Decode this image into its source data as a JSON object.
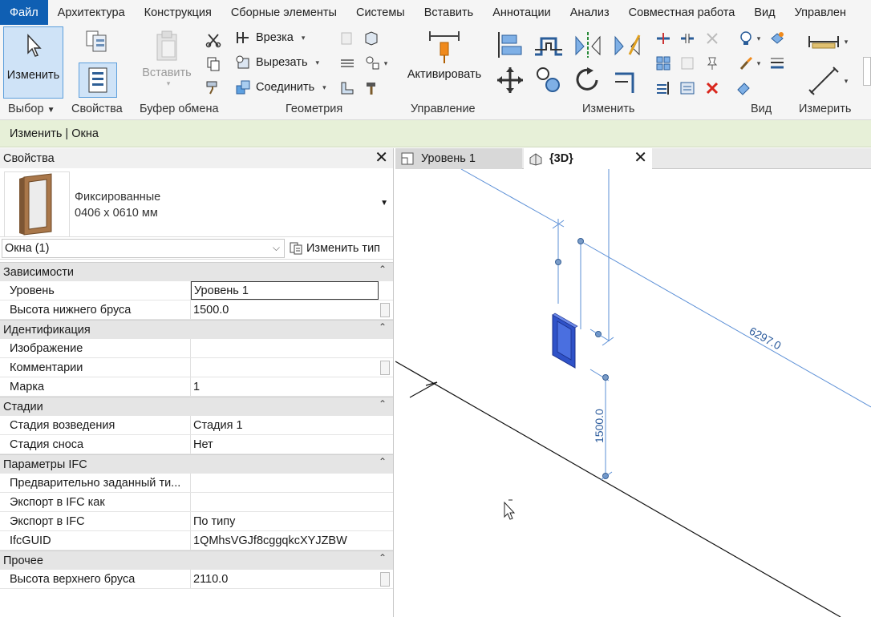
{
  "menu": {
    "tabs": [
      {
        "label": "Файл"
      },
      {
        "label": "Архитектура"
      },
      {
        "label": "Конструкция"
      },
      {
        "label": "Сборные элементы"
      },
      {
        "label": "Системы"
      },
      {
        "label": "Вставить"
      },
      {
        "label": "Аннотации"
      },
      {
        "label": "Анализ"
      },
      {
        "label": "Совместная работа"
      },
      {
        "label": "Вид"
      },
      {
        "label": "Управлен"
      }
    ]
  },
  "ribbon": {
    "modify_label": "Изменить",
    "paste_label": "Вставить",
    "cope_label": "Врезка",
    "cut_label": "Вырезать",
    "join_label": "Соединить",
    "activate_label": "Активировать",
    "panels": {
      "select": "Выбор",
      "properties": "Свойства",
      "clipboard": "Буфер обмена",
      "geometry": "Геометрия",
      "control": "Управление",
      "modify": "Изменить",
      "view": "Вид",
      "measure": "Измерить"
    }
  },
  "context": {
    "text": "Изменить | Окна"
  },
  "properties": {
    "title": "Свойства",
    "type_name_line1": "Фиксированные",
    "type_name_line2": "0406 x 0610 мм",
    "instance_selector": "Окна (1)",
    "edit_type_label": "Изменить тип",
    "groups": [
      {
        "name": "Зависимости",
        "rows": [
          {
            "name": "Уровень",
            "value": "Уровень 1"
          },
          {
            "name": "Высота нижнего бруса",
            "value": "1500.0"
          }
        ]
      },
      {
        "name": "Идентификация",
        "rows": [
          {
            "name": "Изображение",
            "value": ""
          },
          {
            "name": "Комментарии",
            "value": ""
          },
          {
            "name": "Марка",
            "value": "1"
          }
        ]
      },
      {
        "name": "Стадии",
        "rows": [
          {
            "name": "Стадия возведения",
            "value": "Стадия 1"
          },
          {
            "name": "Стадия сноса",
            "value": "Нет"
          }
        ]
      },
      {
        "name": "Параметры IFC",
        "rows": [
          {
            "name": "Предварительно заданный ти...",
            "value": ""
          },
          {
            "name": "Экспорт в IFC как",
            "value": ""
          },
          {
            "name": "Экспорт в IFC",
            "value": "По типу"
          },
          {
            "name": "IfcGUID",
            "value": "1QMhsVGJf8cggqkcXYJZBW"
          }
        ]
      },
      {
        "name": "Прочее",
        "rows": [
          {
            "name": "Высота верхнего бруса",
            "value": "2110.0"
          }
        ]
      }
    ]
  },
  "views": {
    "tabs": [
      {
        "label": "Уровень 1"
      },
      {
        "label": "{3D}"
      }
    ],
    "dimensions": {
      "horizontal": "6297.0",
      "vertical": "1500.0"
    }
  },
  "colors": {
    "file_tab": "#0f5fb3",
    "context_bar": "#e7f0d8",
    "selection_blue": "#2f52c8",
    "dimension_line": "#5b8fd6"
  }
}
